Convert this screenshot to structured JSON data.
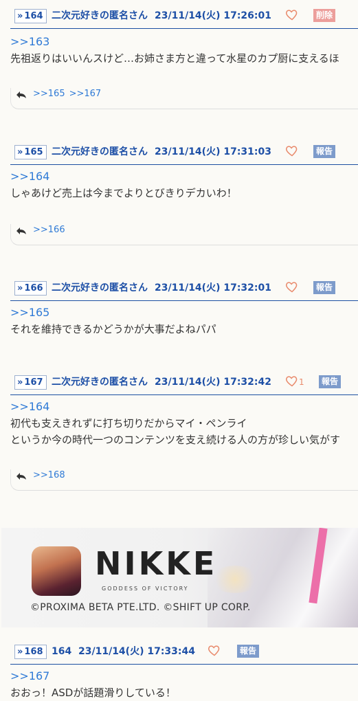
{
  "posts": [
    {
      "num": "164",
      "name": "二次元好きの匿名さん",
      "date": "23/11/14(火) 17:26:01",
      "likes": "",
      "badge": "削除",
      "body_anchor": ">>163",
      "body_lines": [
        "先祖返りはいいんスけど…お姉さま方と違って水星のカプ厨に支えるほ"
      ],
      "replies": [
        ">>165",
        ">>167"
      ]
    },
    {
      "num": "165",
      "name": "二次元好きの匿名さん",
      "date": "23/11/14(火) 17:31:03",
      "likes": "",
      "badge": "報告",
      "body_anchor": ">>164",
      "body_lines": [
        "しゃあけど売上は今までよりとびきりデカいわ！"
      ],
      "replies": [
        ">>166"
      ]
    },
    {
      "num": "166",
      "name": "二次元好きの匿名さん",
      "date": "23/11/14(火) 17:32:01",
      "likes": "",
      "badge": "報告",
      "body_anchor": ">>165",
      "body_lines": [
        "それを維持できるかどうかが大事だよねパパ"
      ],
      "replies": []
    },
    {
      "num": "167",
      "name": "二次元好きの匿名さん",
      "date": "23/11/14(火) 17:32:42",
      "likes": "1",
      "badge": "報告",
      "body_anchor": ">>164",
      "body_lines": [
        "初代も支えきれずに打ち切りだからマイ・ペンライ",
        "というか今の時代一つのコンテンツを支え続ける人の方が珍しい気がす"
      ],
      "replies": [
        ">>168"
      ]
    },
    {
      "num": "168",
      "name": "164",
      "date": "23/11/14(火) 17:33:44",
      "likes": "",
      "badge": "報告",
      "body_anchor": ">>167",
      "body_lines": [
        "おおっ！ASDが話題滑りしている！"
      ],
      "replies": []
    }
  ],
  "ad": {
    "logo": "NIKKE",
    "tagline": "GODDESS OF VICTORY",
    "copyright": "©PROXIMA BETA PTE.LTD. ©SHIFT UP CORP."
  },
  "colors": {
    "accent": "#1d4fa6",
    "link": "#2f7ad6",
    "report_badge": "#7d9bcb",
    "delete_badge": "#ec9e9b",
    "heart": "#e98a6c"
  }
}
